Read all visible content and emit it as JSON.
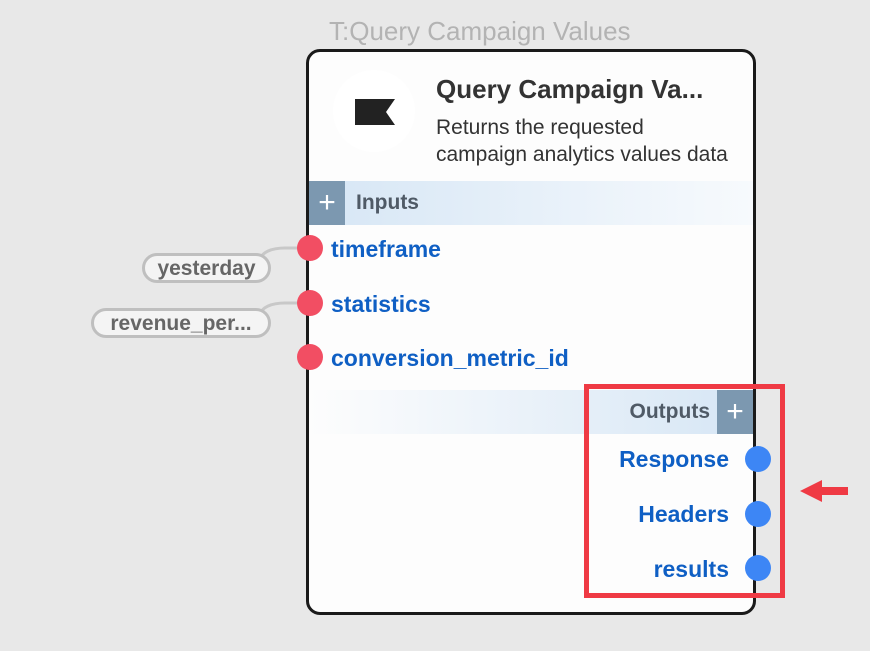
{
  "node": {
    "caption": "T:Query Campaign Values",
    "title": "Query Campaign Va...",
    "description": "Returns the requested campaign analytics values data",
    "logo_icon": "flag-icon",
    "inputs_header": "Inputs",
    "outputs_header": "Outputs",
    "add_symbol": "+",
    "inputs": [
      {
        "label": "timeframe",
        "value": "yesterday"
      },
      {
        "label": "statistics",
        "value": "revenue_per..."
      },
      {
        "label": "conversion_metric_id",
        "value": ""
      }
    ],
    "outputs": [
      {
        "label": "Response"
      },
      {
        "label": "Headers"
      },
      {
        "label": "results"
      }
    ]
  },
  "colors": {
    "input_port": "#f24e63",
    "output_port": "#3d86f5",
    "field_label": "#0f5fc4",
    "highlight": "#ef3a44"
  },
  "annotation": {
    "pointer_icon": "red-arrow-icon"
  }
}
